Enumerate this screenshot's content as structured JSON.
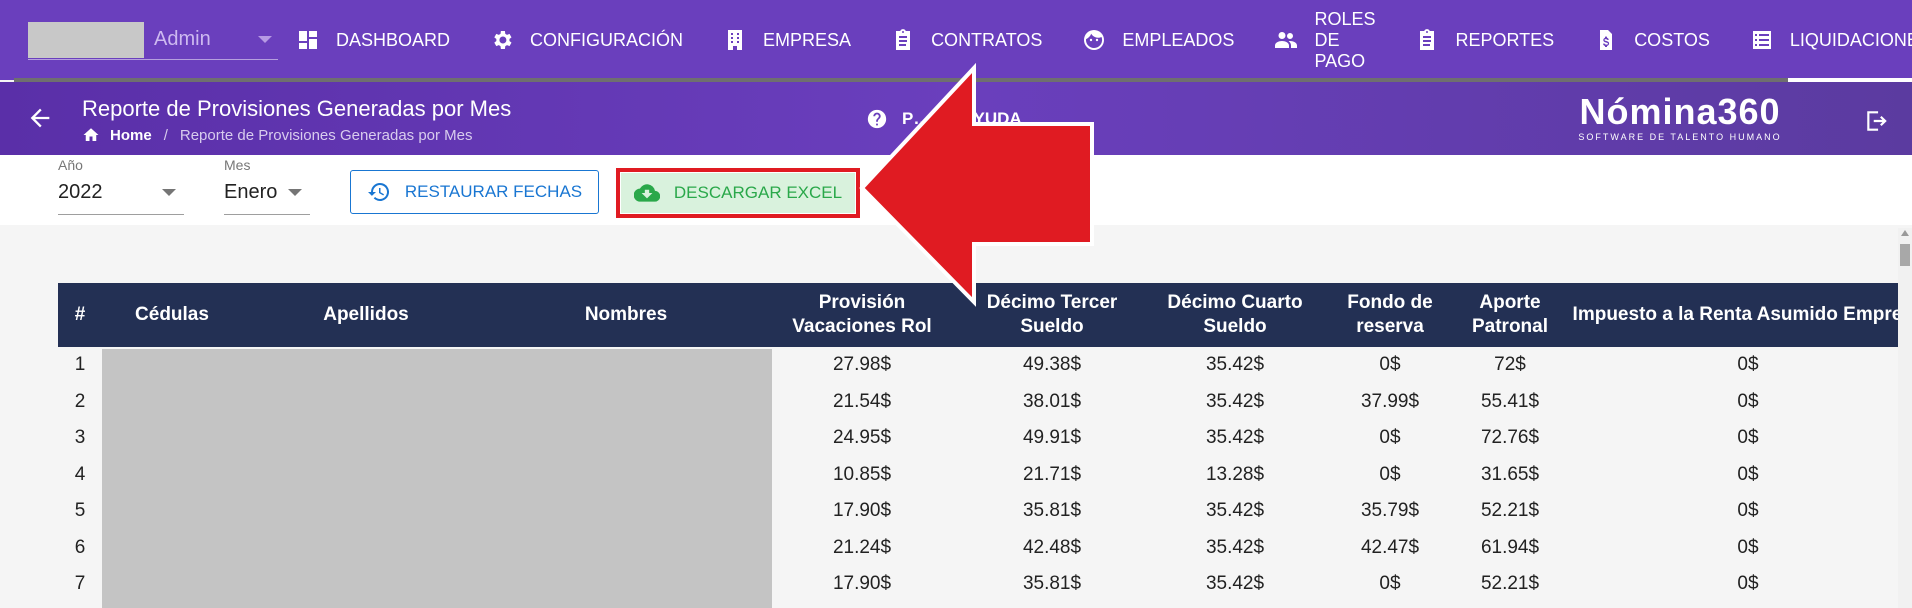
{
  "user": {
    "name": "Admin"
  },
  "nav": {
    "items": [
      {
        "label": "DASHBOARD",
        "icon": "dashboard-icon"
      },
      {
        "label": "CONFIGURACIÓN",
        "icon": "gear-icon"
      },
      {
        "label": "EMPRESA",
        "icon": "building-icon"
      },
      {
        "label": "CONTRATOS",
        "icon": "clipboard-icon"
      },
      {
        "label": "EMPLEADOS",
        "icon": "face-icon"
      },
      {
        "label": "ROLES DE PAGO",
        "icon": "people-icon"
      },
      {
        "label": "REPORTES",
        "icon": "clipboard-icon"
      },
      {
        "label": "COSTOS",
        "icon": "file-dollar-icon"
      },
      {
        "label": "LIQUIDACIONES",
        "icon": "list-icon"
      }
    ]
  },
  "header": {
    "title": "Reporte de Provisiones Generadas por Mes",
    "breadcrumb_home": "Home",
    "breadcrumb_current": "Reporte de Provisiones Generadas por Mes",
    "help_label": "P… DE AYUDA",
    "brand_name": "Nómina360",
    "brand_sub": "SOFTWARE DE TALENTO HUMANO"
  },
  "filters": {
    "year_label": "Año",
    "year_value": "2022",
    "month_label": "Mes",
    "month_value": "Enero",
    "restore_label": "RESTAURAR FECHAS",
    "excel_label": "DESCARGAR EXCEL"
  },
  "colors": {
    "nav_bg": "#6a3fbd",
    "table_header_bg": "#233054",
    "annotation_red": "#e01b22",
    "excel_green": "#2aa84a",
    "primary_blue": "#1976d2"
  },
  "table": {
    "headers": {
      "num": "#",
      "cedulas": "Cédulas",
      "apellidos": "Apellidos",
      "nombres": "Nombres",
      "vacaciones": "Provisión Vacaciones Rol",
      "decimo_tercer": "Décimo Tercer Sueldo",
      "decimo_cuarto": "Décimo Cuarto Sueldo",
      "fondo_reserva": "Fondo de reserva",
      "aporte_patronal": "Aporte Patronal",
      "impuesto": "Impuesto a la Renta Asumido Empresa"
    },
    "rows": [
      {
        "n": "1",
        "vac": "27.98$",
        "d13": "49.38$",
        "d14": "35.42$",
        "fondo": "0$",
        "aporte": "72$",
        "imp": "0$"
      },
      {
        "n": "2",
        "vac": "21.54$",
        "d13": "38.01$",
        "d14": "35.42$",
        "fondo": "37.99$",
        "aporte": "55.41$",
        "imp": "0$"
      },
      {
        "n": "3",
        "vac": "24.95$",
        "d13": "49.91$",
        "d14": "35.42$",
        "fondo": "0$",
        "aporte": "72.76$",
        "imp": "0$"
      },
      {
        "n": "4",
        "vac": "10.85$",
        "d13": "21.71$",
        "d14": "13.28$",
        "fondo": "0$",
        "aporte": "31.65$",
        "imp": "0$"
      },
      {
        "n": "5",
        "vac": "17.90$",
        "d13": "35.81$",
        "d14": "35.42$",
        "fondo": "35.79$",
        "aporte": "52.21$",
        "imp": "0$"
      },
      {
        "n": "6",
        "vac": "21.24$",
        "d13": "42.48$",
        "d14": "35.42$",
        "fondo": "42.47$",
        "aporte": "61.94$",
        "imp": "0$"
      },
      {
        "n": "7",
        "vac": "17.90$",
        "d13": "35.81$",
        "d14": "35.42$",
        "fondo": "0$",
        "aporte": "52.21$",
        "imp": "0$"
      }
    ]
  }
}
